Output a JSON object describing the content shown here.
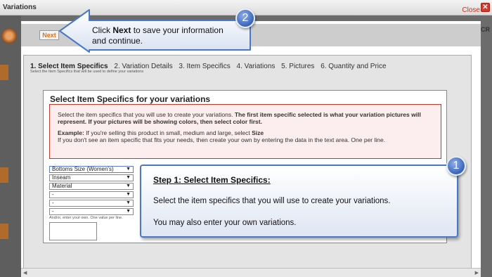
{
  "window": {
    "title": "Variations",
    "close_label": "Close",
    "close_icon": "✕"
  },
  "background": {
    "side_text": "CR"
  },
  "toolbar": {
    "next_label": "Next"
  },
  "wizard": {
    "steps": [
      "1. Select Item Specifics",
      "2. Variation Details",
      "3. Item Specifics",
      "4. Variations",
      "5. Pictures",
      "6. Quantity and Price"
    ],
    "step_sub": "Select the Item Specifics that will be used to define your variations"
  },
  "section": {
    "title": "Select Item Specifics for your variations",
    "intro_plain": "Select the item specifics that you will use to create your variations. ",
    "intro_bold": "The first item specific selected is what your variation pictures will represent. If your pictures will be showing colors, then select color first.",
    "example_label": "Example:",
    "example_text": " If you're selling this product in small, medium and large, select ",
    "example_value": "Size",
    "example_line2": "If you don't see an item specific that fits your needs, then create your own by entering the data in the text area. One per line."
  },
  "selects": [
    "Bottoms Size (Women's)",
    "Inseam",
    "Material",
    "-",
    "-",
    "-"
  ],
  "andor_text": "And/or, enter your own. One value per line.",
  "callout_next": {
    "prefix": "Click ",
    "bold": "Next",
    "suffix": " to save your information",
    "line2": "and continue.",
    "badge": "2"
  },
  "callout_step1": {
    "heading": "Step 1: Select Item Specifics:",
    "line1": "Select the item specifics that you will use to create your variations.",
    "line2": "You may also enter your own variations.",
    "badge": "1"
  },
  "colors": {
    "accent_blue": "#4a78c8",
    "next_orange": "#e0701a",
    "info_border": "#c0392b"
  }
}
